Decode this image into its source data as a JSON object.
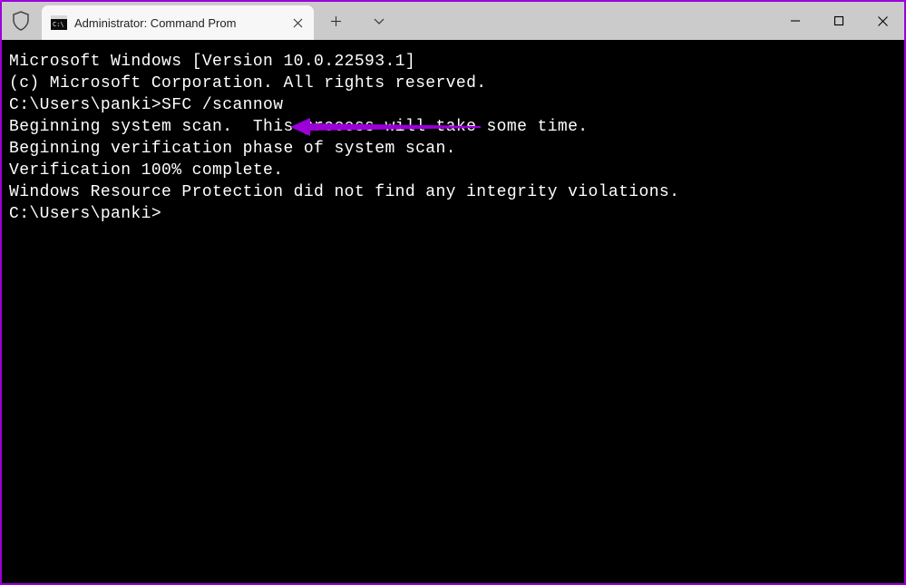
{
  "tab": {
    "title": "Administrator: Command Prom",
    "icon_name": "cmd-icon"
  },
  "terminal": {
    "lines": [
      "Microsoft Windows [Version 10.0.22593.1]",
      "(c) Microsoft Corporation. All rights reserved.",
      "",
      "C:\\Users\\panki>SFC /scannow",
      "",
      "Beginning system scan.  This process will take some time.",
      "",
      "Beginning verification phase of system scan.",
      "Verification 100% complete.",
      "",
      "Windows Resource Protection did not find any integrity violations.",
      "",
      "C:\\Users\\panki>"
    ]
  },
  "annotation": {
    "arrow_color": "#9b00d9"
  }
}
